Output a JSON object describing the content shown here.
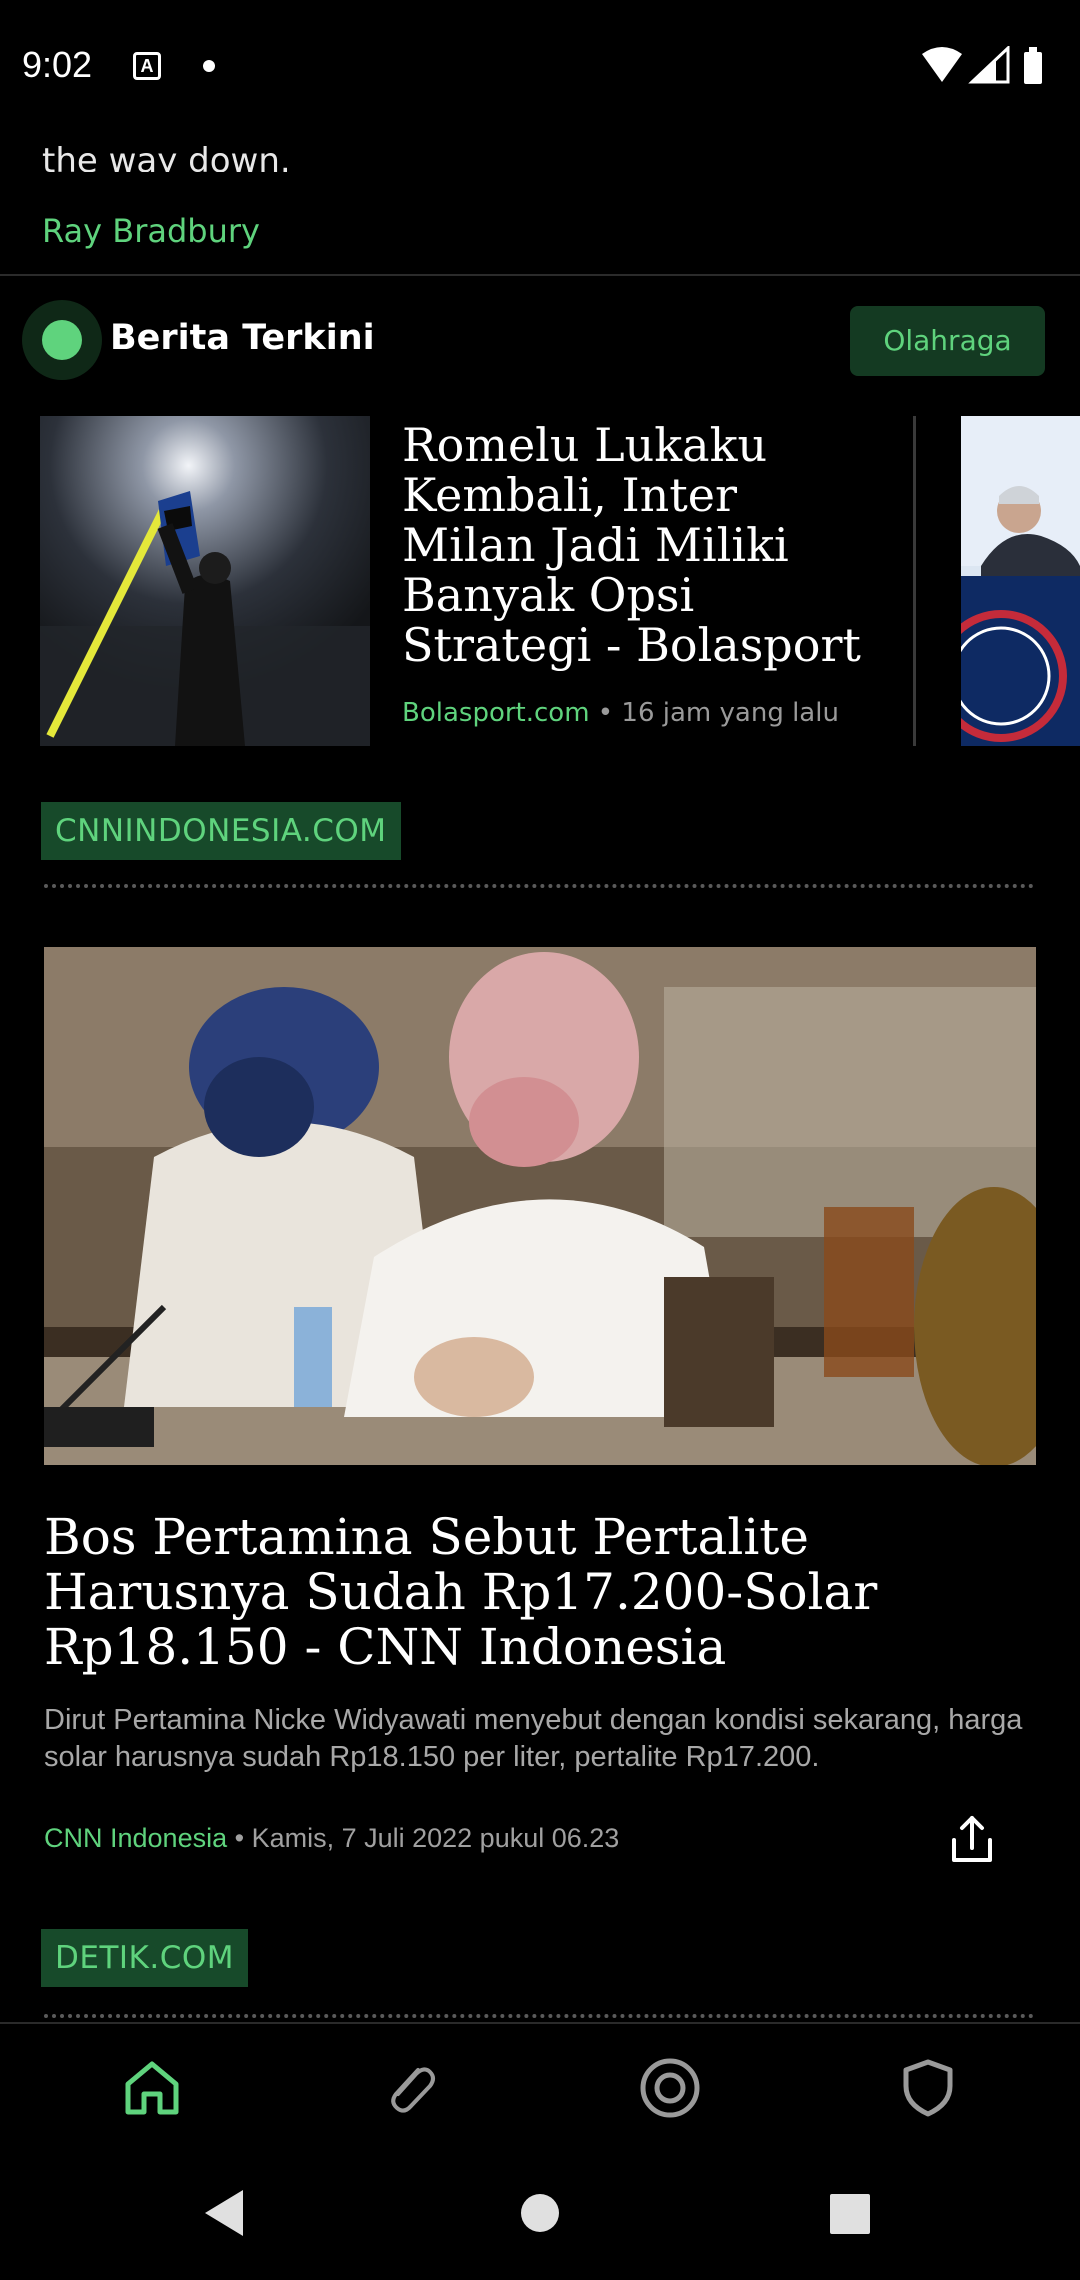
{
  "status_bar": {
    "time": "9:02",
    "notification_icon": "A"
  },
  "quote": {
    "tail_text": "the way down.",
    "author": "Ray Bradbury"
  },
  "section": {
    "title": "Berita Terkini",
    "category_chip": "Olahraga"
  },
  "carousel": [
    {
      "title": "Romelu Lukaku Kembali, Inter Milan Jadi Miliki Banyak Opsi Strategi - Bolasport",
      "source": "Bolasport.com",
      "separator": " • ",
      "time": "16 jam yang lalu"
    }
  ],
  "publishers": [
    {
      "label": "CNNINDONESIA.COM"
    },
    {
      "label": "DETIK.COM"
    }
  ],
  "main_article": {
    "title": "Bos Pertamina Sebut Pertalite Harusnya Sudah Rp17.200-Solar Rp18.150 - CNN Indonesia",
    "description": "Dirut Pertamina Nicke Widyawati menyebut dengan kondisi sekarang, harga solar harusnya sudah Rp18.150 per liter, pertalite Rp17.200.",
    "source": "CNN Indonesia",
    "separator": " • ",
    "date": "Kamis, 7 Juli 2022 pukul 06.23"
  },
  "bottom_nav": [
    "home-icon",
    "paperclip-icon",
    "target-icon",
    "shield-icon"
  ],
  "colors": {
    "accent": "#5fd37d",
    "chip_bg": "#143a22",
    "label_bg": "#174a2a",
    "background": "#000000"
  }
}
